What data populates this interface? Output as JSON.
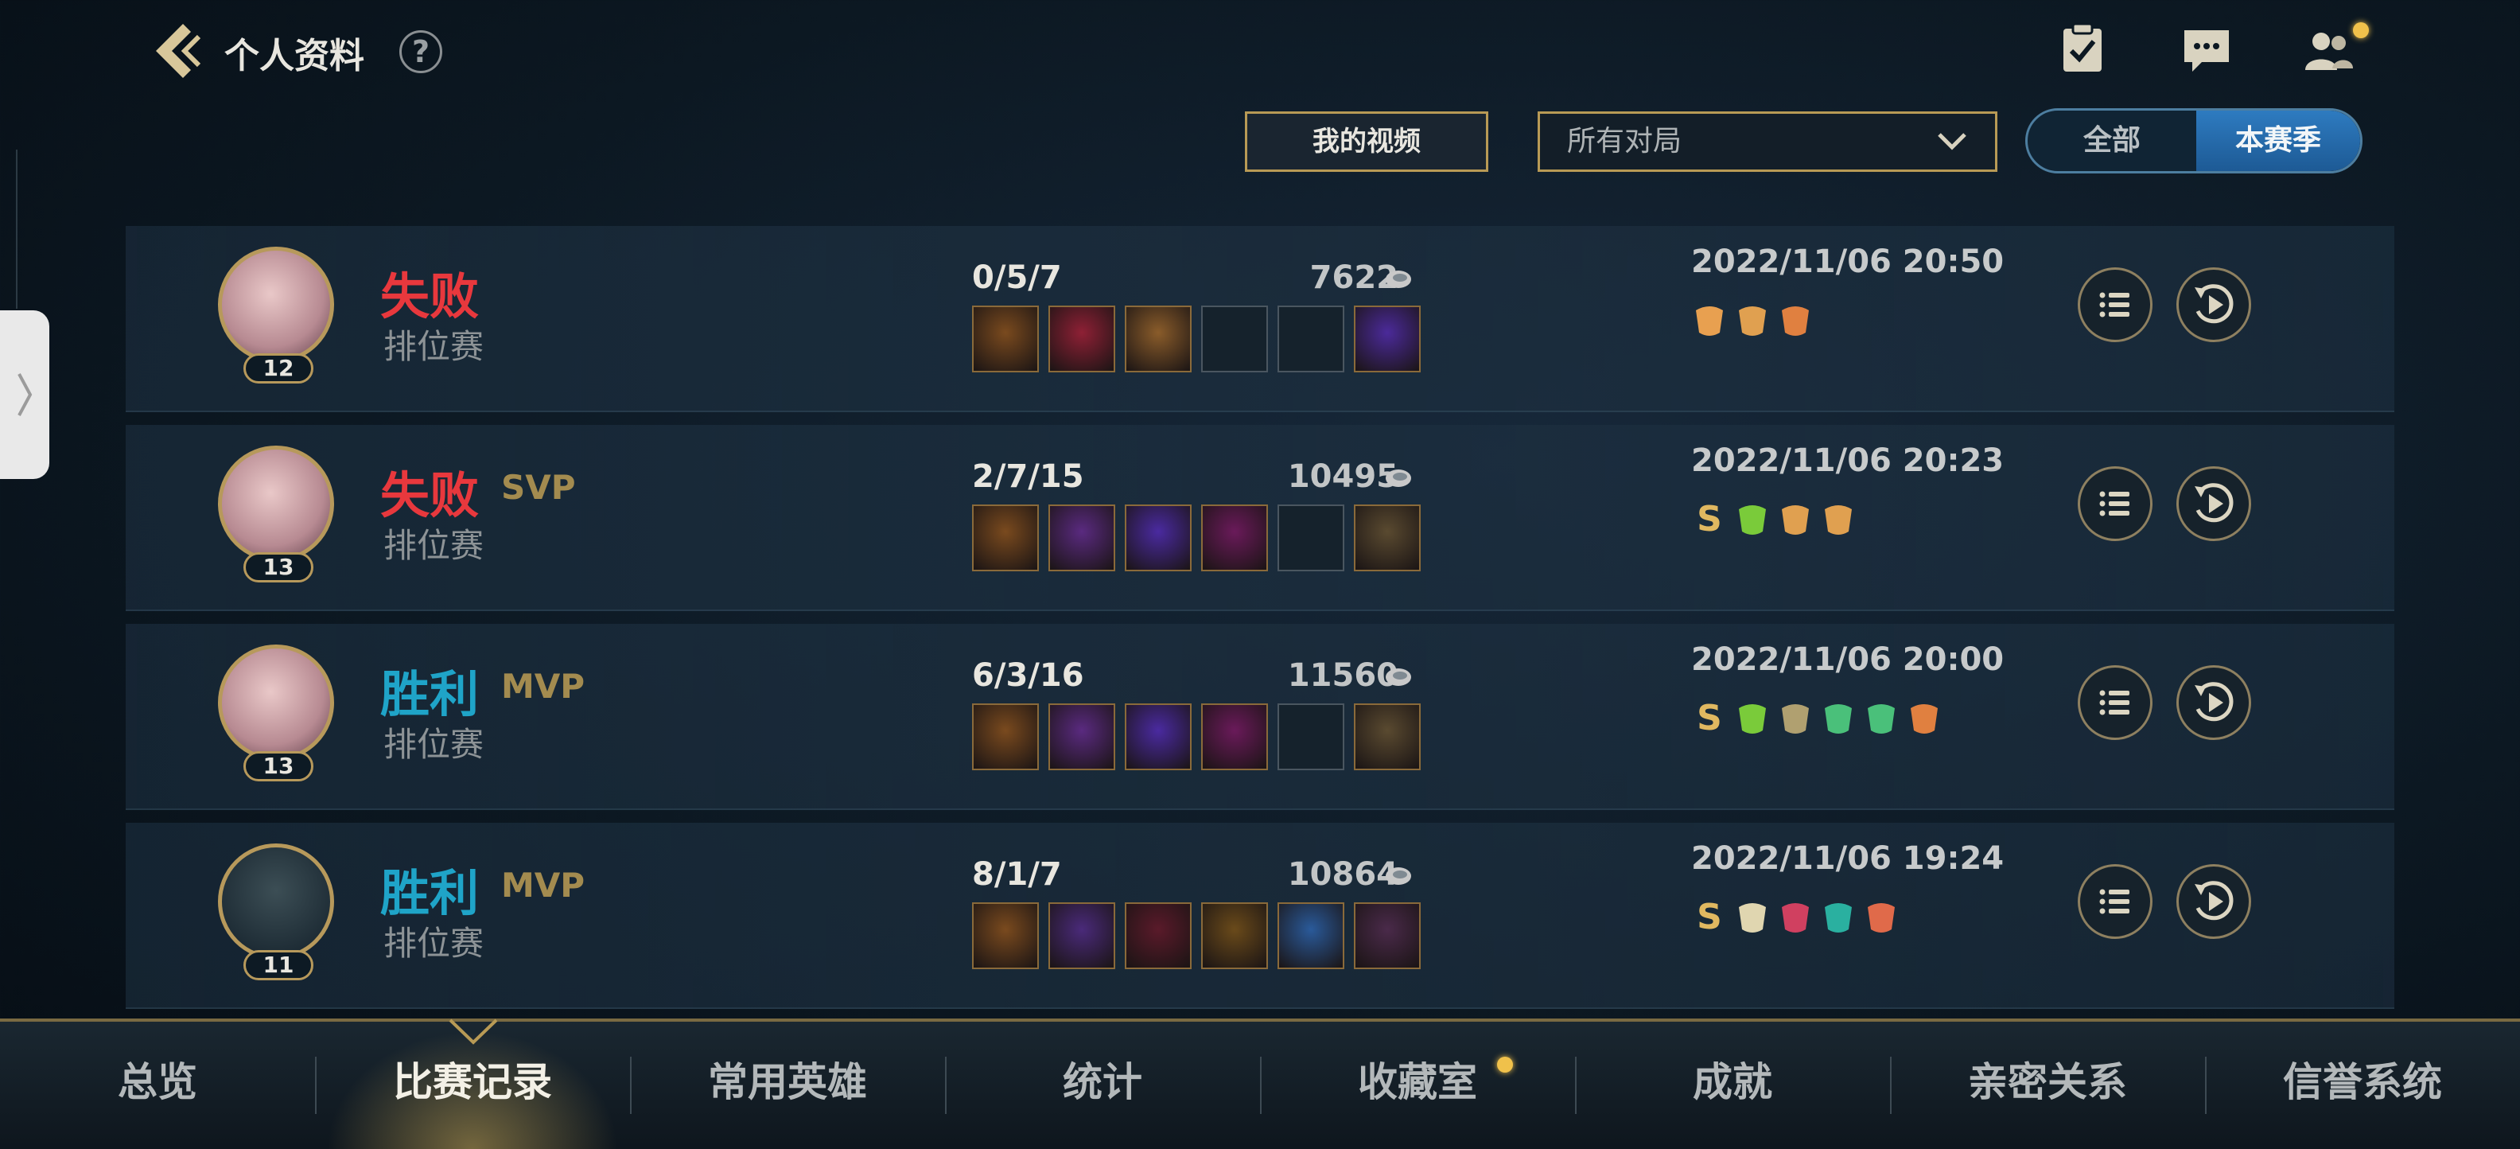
{
  "header": {
    "title": "个人资料",
    "help": "?"
  },
  "controls": {
    "video_button": "我的视频",
    "filter": {
      "value": "所有对局"
    },
    "segment": {
      "all": "全部",
      "season": "本赛季",
      "selected": "本赛季"
    }
  },
  "matches": [
    {
      "result": "失败",
      "result_type": "loss",
      "badge": "",
      "mode": "排位赛",
      "level": "12",
      "kda": "0/5/7",
      "gold": "7622",
      "date": "2022/11/06 20:50",
      "tags": [
        "",
        "",
        ""
      ],
      "empty_slots": [
        3,
        4
      ]
    },
    {
      "result": "失败",
      "result_type": "loss",
      "badge": "SVP",
      "mode": "排位赛",
      "level": "13",
      "kda": "2/7/15",
      "gold": "10495",
      "date": "2022/11/06 20:23",
      "tags": [
        "S",
        "",
        "",
        ""
      ],
      "empty_slots": [
        4
      ]
    },
    {
      "result": "胜利",
      "result_type": "win",
      "badge": "MVP",
      "mode": "排位赛",
      "level": "13",
      "kda": "6/3/16",
      "gold": "11560",
      "date": "2022/11/06 20:00",
      "tags": [
        "S",
        "",
        "",
        "",
        "",
        ""
      ],
      "empty_slots": [
        4
      ]
    },
    {
      "result": "胜利",
      "result_type": "win",
      "badge": "MVP",
      "mode": "排位赛",
      "level": "11",
      "kda": "8/1/7",
      "gold": "10864",
      "date": "2022/11/06 19:24",
      "tags": [
        "S",
        "",
        "",
        "",
        ""
      ],
      "empty_slots": []
    }
  ],
  "nav": {
    "items": [
      "总览",
      "比赛记录",
      "常用英雄",
      "统计",
      "收藏室",
      "成就",
      "亲密关系",
      "信誉系统"
    ],
    "active": "比赛记录"
  },
  "colors": {
    "loss": "#e8383d",
    "win": "#1fa4c8",
    "gold_border": "#b89a55",
    "accent_blue": "#2e7bc0"
  }
}
